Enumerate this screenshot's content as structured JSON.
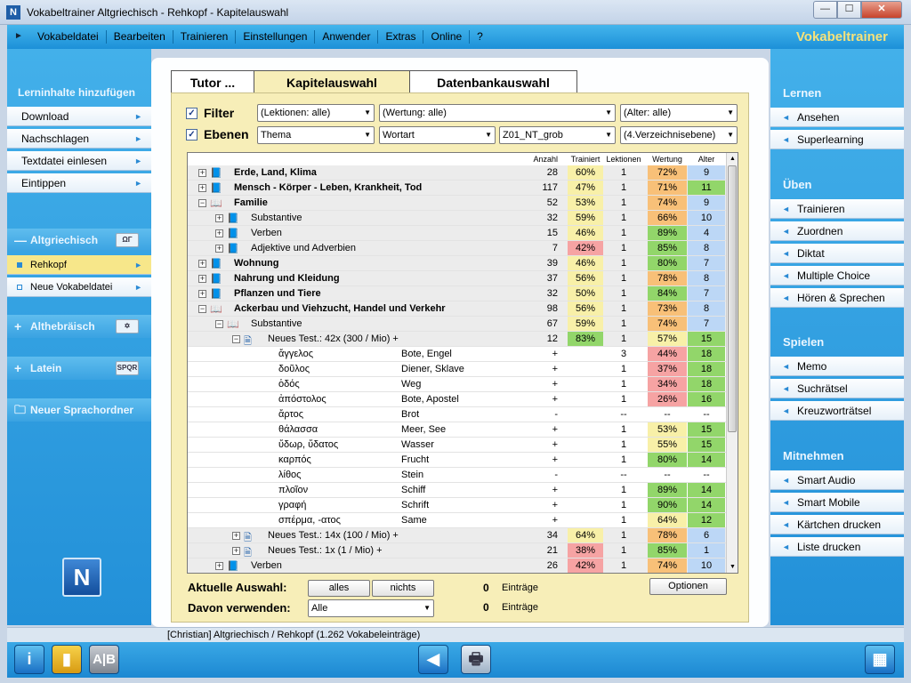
{
  "window": {
    "title": "Vokabeltrainer Altgriechisch - Rehkopf - Kapitelauswahl",
    "app_icon": "N"
  },
  "menu": {
    "items": [
      "Vokabeldatei",
      "Bearbeiten",
      "Trainieren",
      "Einstellungen",
      "Anwender",
      "Extras",
      "Online",
      "?"
    ],
    "brand": "Vokabeltrainer"
  },
  "left": {
    "header": "Lerninhalte hinzufügen",
    "buttons": [
      "Download",
      "Nachschlagen",
      "Textdatei einlesen",
      "Eintippen"
    ],
    "langs": [
      {
        "label": "Altgriechisch",
        "badge": "ΩΓ",
        "sym": "—"
      },
      {
        "label": "Althebräisch",
        "badge": "✡",
        "sym": "+"
      },
      {
        "label": "Latein",
        "badge": "SPQR",
        "sym": "+"
      }
    ],
    "subitems": [
      "Rehkopf",
      "Neue Vokabeldatei"
    ],
    "new_folder": "Neuer Sprachordner"
  },
  "right": {
    "sections": [
      {
        "title": "Lernen",
        "items": [
          "Ansehen",
          "Superlearning"
        ]
      },
      {
        "title": "Üben",
        "items": [
          "Trainieren",
          "Zuordnen",
          "Diktat",
          "Multiple Choice",
          "Hören & Sprechen"
        ]
      },
      {
        "title": "Spielen",
        "items": [
          "Memo",
          "Suchrätsel",
          "Kreuzworträtsel"
        ]
      },
      {
        "title": "Mitnehmen",
        "items": [
          "Smart Audio",
          "Smart Mobile",
          "Kärtchen drucken",
          "Liste drucken"
        ]
      }
    ]
  },
  "tabs": [
    "Tutor ...",
    "Kapitelauswahl",
    "Datenbankauswahl"
  ],
  "filter": {
    "filter_label": "Filter",
    "ebenen_label": "Ebenen",
    "filter_dd": [
      "(Lektionen: alle)",
      "(Wertung: alle)",
      "(Alter: alle)"
    ],
    "ebenen_dd": [
      "Thema",
      "Wortart",
      "Z01_NT_grob",
      "(4.Verzeichnisebene)"
    ]
  },
  "grid": {
    "headers": [
      "Anzahl",
      "Trainiert",
      "Lektionen",
      "Wertung",
      "Alter"
    ],
    "rows": [
      {
        "lvl": 0,
        "exp": "+",
        "icon": "book",
        "name": "Erde, Land, Klima",
        "bold": true,
        "a": "28",
        "t": "60%",
        "tc": "yel",
        "l": "1",
        "w": "72%",
        "wc": "or",
        "al": "9",
        "alc": "bl",
        "grp": true
      },
      {
        "lvl": 0,
        "exp": "+",
        "icon": "book",
        "name": "Mensch - Körper - Leben, Krankheit, Tod",
        "bold": true,
        "a": "117",
        "t": "47%",
        "tc": "yel",
        "l": "1",
        "w": "71%",
        "wc": "or",
        "al": "11",
        "alc": "gn",
        "grp": true
      },
      {
        "lvl": 0,
        "exp": "−",
        "icon": "open",
        "name": "Familie",
        "bold": true,
        "a": "52",
        "t": "53%",
        "tc": "yel",
        "l": "1",
        "w": "74%",
        "wc": "or",
        "al": "9",
        "alc": "bl",
        "grp": true
      },
      {
        "lvl": 1,
        "exp": "+",
        "icon": "book",
        "name": "Substantive",
        "a": "32",
        "t": "59%",
        "tc": "yel",
        "l": "1",
        "w": "66%",
        "wc": "or",
        "al": "10",
        "alc": "bl",
        "grp": true
      },
      {
        "lvl": 1,
        "exp": "+",
        "icon": "book",
        "name": "Verben",
        "a": "15",
        "t": "46%",
        "tc": "yel",
        "l": "1",
        "w": "89%",
        "wc": "gn",
        "al": "4",
        "alc": "bl",
        "grp": true
      },
      {
        "lvl": 1,
        "exp": "+",
        "icon": "book",
        "name": "Adjektive und Adverbien",
        "a": "7",
        "t": "42%",
        "tc": "pk",
        "l": "1",
        "w": "85%",
        "wc": "gn",
        "al": "8",
        "alc": "bl",
        "grp": true
      },
      {
        "lvl": 0,
        "exp": "+",
        "icon": "book",
        "name": "Wohnung",
        "bold": true,
        "a": "39",
        "t": "46%",
        "tc": "yel",
        "l": "1",
        "w": "80%",
        "wc": "gn",
        "al": "7",
        "alc": "bl",
        "grp": true
      },
      {
        "lvl": 0,
        "exp": "+",
        "icon": "book",
        "name": "Nahrung und Kleidung",
        "bold": true,
        "a": "37",
        "t": "56%",
        "tc": "yel",
        "l": "1",
        "w": "78%",
        "wc": "or",
        "al": "8",
        "alc": "bl",
        "grp": true
      },
      {
        "lvl": 0,
        "exp": "+",
        "icon": "book",
        "name": "Pflanzen und Tiere",
        "bold": true,
        "a": "32",
        "t": "50%",
        "tc": "yel",
        "l": "1",
        "w": "84%",
        "wc": "gn",
        "al": "7",
        "alc": "bl",
        "grp": true
      },
      {
        "lvl": 0,
        "exp": "−",
        "icon": "open",
        "name": "Ackerbau und Viehzucht, Handel und Verkehr",
        "bold": true,
        "a": "98",
        "t": "56%",
        "tc": "yel",
        "l": "1",
        "w": "73%",
        "wc": "or",
        "al": "8",
        "alc": "bl",
        "grp": true
      },
      {
        "lvl": 1,
        "exp": "−",
        "icon": "open",
        "name": "Substantive",
        "a": "67",
        "t": "59%",
        "tc": "yel",
        "l": "1",
        "w": "74%",
        "wc": "or",
        "al": "7",
        "alc": "bl",
        "grp": true
      },
      {
        "lvl": 2,
        "exp": "−",
        "icon": "doc",
        "name": "Neues Test.:  42x  (300 / Mio) +",
        "a": "12",
        "t": "83%",
        "tc": "gn",
        "l": "1",
        "w": "57%",
        "wc": "yel",
        "al": "15",
        "alc": "gn",
        "grp": true
      },
      {
        "lvl": 3,
        "word": "ἄγγελος",
        "de": "Bote, Engel",
        "a": "+",
        "l": "3",
        "w": "44%",
        "wc": "pk",
        "al": "18",
        "alc": "gn"
      },
      {
        "lvl": 3,
        "word": "δοῦλος",
        "de": "Diener, Sklave",
        "a": "+",
        "l": "1",
        "w": "37%",
        "wc": "pk",
        "al": "18",
        "alc": "gn"
      },
      {
        "lvl": 3,
        "word": "ὁδός",
        "de": "Weg",
        "a": "+",
        "l": "1",
        "w": "34%",
        "wc": "pk",
        "al": "18",
        "alc": "gn"
      },
      {
        "lvl": 3,
        "word": "ἀπόστολος",
        "de": "Bote, Apostel",
        "a": "+",
        "l": "1",
        "w": "26%",
        "wc": "pk",
        "al": "16",
        "alc": "gn"
      },
      {
        "lvl": 3,
        "word": "ἄρτος",
        "de": "Brot",
        "a": "-",
        "l": "--",
        "w": "--",
        "al": "--"
      },
      {
        "lvl": 3,
        "word": "θάλασσα",
        "de": "Meer, See",
        "a": "+",
        "l": "1",
        "w": "53%",
        "wc": "yel",
        "al": "15",
        "alc": "gn"
      },
      {
        "lvl": 3,
        "word": "ὕδωρ, ὕδατος",
        "de": "Wasser",
        "a": "+",
        "l": "1",
        "w": "55%",
        "wc": "yel",
        "al": "15",
        "alc": "gn"
      },
      {
        "lvl": 3,
        "word": "καρπός",
        "de": "Frucht",
        "a": "+",
        "l": "1",
        "w": "80%",
        "wc": "gn",
        "al": "14",
        "alc": "gn"
      },
      {
        "lvl": 3,
        "word": "λίθος",
        "de": "Stein",
        "a": "-",
        "l": "--",
        "w": "--",
        "al": "--"
      },
      {
        "lvl": 3,
        "word": "πλοῖον",
        "de": "Schiff",
        "a": "+",
        "l": "1",
        "w": "89%",
        "wc": "gn",
        "al": "14",
        "alc": "gn"
      },
      {
        "lvl": 3,
        "word": "γραφή",
        "de": "Schrift",
        "a": "+",
        "l": "1",
        "w": "90%",
        "wc": "gn",
        "al": "14",
        "alc": "gn"
      },
      {
        "lvl": 3,
        "word": "σπέρμα, -ατος",
        "de": "Same",
        "a": "+",
        "l": "1",
        "w": "64%",
        "wc": "yel",
        "al": "12",
        "alc": "gn"
      },
      {
        "lvl": 2,
        "exp": "+",
        "icon": "doc",
        "name": "Neues Test.:  14x  (100 / Mio) +",
        "a": "34",
        "t": "64%",
        "tc": "yel",
        "l": "1",
        "w": "78%",
        "wc": "or",
        "al": "6",
        "alc": "bl",
        "grp": true
      },
      {
        "lvl": 2,
        "exp": "+",
        "icon": "doc",
        "name": "Neues Test.:   1x  (1 / Mio) +",
        "a": "21",
        "t": "38%",
        "tc": "pk",
        "l": "1",
        "w": "85%",
        "wc": "gn",
        "al": "1",
        "alc": "bl",
        "grp": true
      },
      {
        "lvl": 1,
        "exp": "+",
        "icon": "book",
        "name": "Verben",
        "a": "26",
        "t": "42%",
        "tc": "pk",
        "l": "1",
        "w": "74%",
        "wc": "or",
        "al": "10",
        "alc": "bl",
        "grp": true
      }
    ]
  },
  "bottom": {
    "aktuelle_label": "Aktuelle Auswahl:",
    "alles": "alles",
    "nichts": "nichts",
    "count1": "0",
    "eintraege1": "Einträge",
    "optionen": "Optionen",
    "davon_label": "Davon verwenden:",
    "davon_value": "Alle",
    "count2": "0",
    "eintraege2": "Einträge"
  },
  "status": "[Christian]  Altgriechisch / Rehkopf  (1.262 Vokabeleinträge)",
  "colors": {
    "accent": "#2290d8",
    "brand": "#f7e27a",
    "panel": "#f7eeb8"
  },
  "bottom_buttons": [
    "info-icon",
    "notebook-icon",
    "ab-icon",
    "back-arrow-icon",
    "printer-icon",
    "grid-icon"
  ]
}
